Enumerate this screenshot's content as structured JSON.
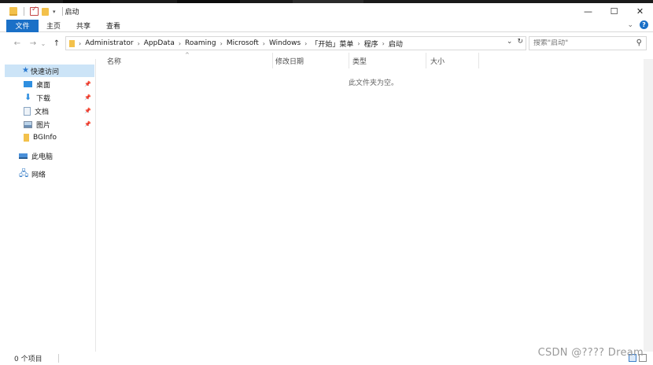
{
  "window": {
    "title": "启动",
    "controls": {
      "minimize": "—",
      "maximize": "☐",
      "close": "✕"
    }
  },
  "ribbon": {
    "tabs": [
      {
        "label": "文件",
        "active": true
      },
      {
        "label": "主页"
      },
      {
        "label": "共享"
      },
      {
        "label": "查看"
      }
    ],
    "expand_icon": "chevron-down-icon",
    "help_glyph": "?"
  },
  "navigation": {
    "back": "←",
    "forward": "→",
    "recent": "⌄",
    "up": "↑"
  },
  "address": {
    "crumbs": [
      "Administrator",
      "AppData",
      "Roaming",
      "Microsoft",
      "Windows",
      "「开始」菜单",
      "程序",
      "启动"
    ],
    "dropdown": "⌄",
    "refresh": "↻"
  },
  "search": {
    "placeholder": "搜索\"启动\""
  },
  "nav_pane": {
    "quick_access": "快速访问",
    "items": [
      {
        "label": "桌面",
        "pinned": true
      },
      {
        "label": "下载",
        "pinned": true
      },
      {
        "label": "文档",
        "pinned": true
      },
      {
        "label": "图片",
        "pinned": true
      },
      {
        "label": "BGInfo",
        "pinned": false
      }
    ],
    "this_pc": "此电脑",
    "network": "网络"
  },
  "columns": [
    "名称",
    "修改日期",
    "类型",
    "大小"
  ],
  "empty_message": "此文件夹为空。",
  "status": {
    "item_count": "0 个项目"
  },
  "watermark": "CSDN @????  Dream",
  "colors": {
    "accent": "#1a70c7",
    "selection": "#cce4f7",
    "folder": "#f3c14b"
  }
}
